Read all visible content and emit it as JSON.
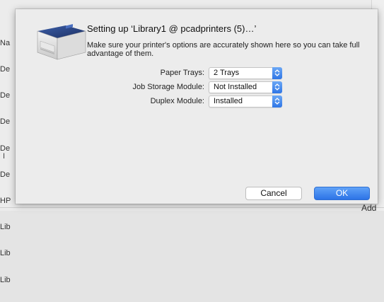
{
  "background": {
    "list_fragments": [
      "Na",
      "De",
      "De",
      "De",
      "De",
      "De",
      "HP",
      "Lib",
      "Lib",
      "Lib"
    ],
    "left_mark": "I",
    "add_label": "Add"
  },
  "dialog": {
    "title": "Setting up ‘Library1 @ pcadprinters (5)…’",
    "description": "Make sure your printer's options are accurately shown here so you can take full advantage of them.",
    "icon": "printer-icon",
    "options": [
      {
        "label": "Paper Trays:",
        "value": "2 Trays"
      },
      {
        "label": "Job Storage Module:",
        "value": "Not Installed"
      },
      {
        "label": "Duplex Module:",
        "value": "Installed"
      }
    ],
    "cancel_label": "Cancel",
    "ok_label": "OK",
    "accent_color": "#2f76e6"
  }
}
